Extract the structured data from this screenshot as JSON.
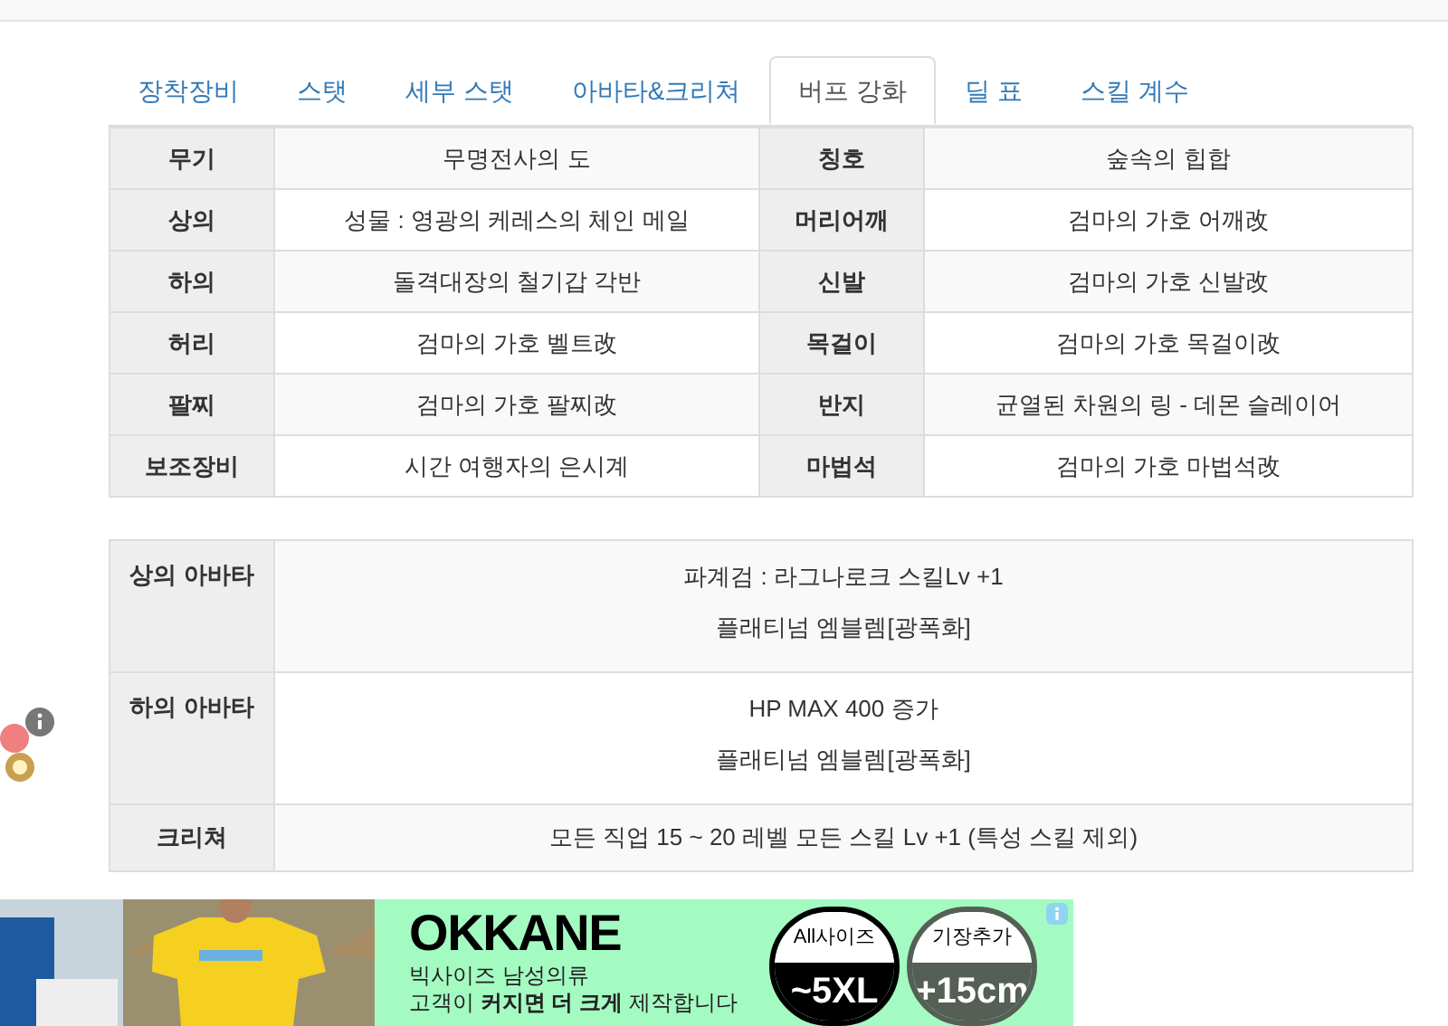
{
  "tabs": [
    {
      "label": "장착장비",
      "selected": false
    },
    {
      "label": "스탯",
      "selected": false
    },
    {
      "label": "세부 스탯",
      "selected": false
    },
    {
      "label": "아바타&크리쳐",
      "selected": false
    },
    {
      "label": "버프 강화",
      "selected": true
    },
    {
      "label": "딜 표",
      "selected": false
    },
    {
      "label": "스킬 계수",
      "selected": false
    }
  ],
  "equipment": [
    [
      "무기",
      "무명전사의 도",
      "칭호",
      "숲속의 힙합"
    ],
    [
      "상의",
      "성물 : 영광의 케레스의 체인 메일",
      "머리어깨",
      "검마의 가호 어깨改"
    ],
    [
      "하의",
      "돌격대장의 철기갑 각반",
      "신발",
      "검마의 가호 신발改"
    ],
    [
      "허리",
      "검마의 가호 벨트改",
      "목걸이",
      "검마의 가호 목걸이改"
    ],
    [
      "팔찌",
      "검마의 가호 팔찌改",
      "반지",
      "균열된 차원의 링 - 데몬 슬레이어"
    ],
    [
      "보조장비",
      "시간 여행자의 은시계",
      "마법석",
      "검마의 가호 마법석改"
    ]
  ],
  "avatar": [
    {
      "label": "상의 아바타",
      "lines": [
        "파계검 : 라그나로크 스킬Lv +1",
        "플래티넘 엠블렘[광폭화]"
      ]
    },
    {
      "label": "하의 아바타",
      "lines": [
        "HP MAX 400 증가",
        "플래티넘 엠블렘[광폭화]"
      ]
    },
    {
      "label": "크리쳐",
      "lines": [
        "모든 직업 15 ~ 20 레벨 모든 스킬 Lv +1 (특성 스킬 제외)"
      ]
    }
  ],
  "ad": {
    "brand": "OKKANE",
    "subtitle": "빅사이즈 남성의류",
    "slogan": "고객이 **커지면 더 크게** 제작합니다",
    "badges": [
      {
        "top": "All사이즈",
        "bottom": "~5XL",
        "color": "#000000"
      },
      {
        "top": "기장추가",
        "bottom": "+15cm",
        "color": "#555f55"
      }
    ]
  }
}
